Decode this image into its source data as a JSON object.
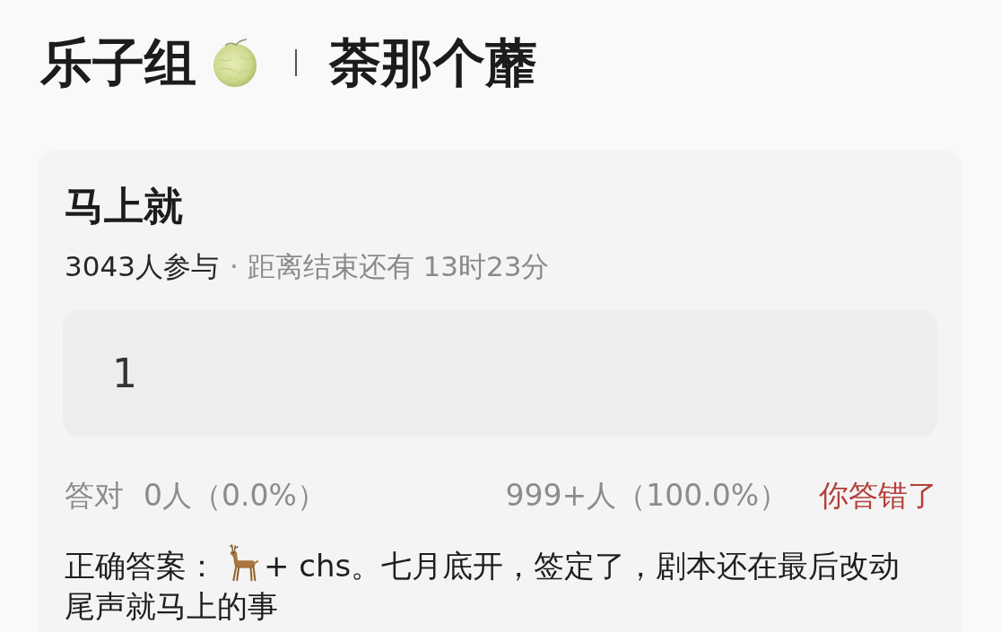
{
  "header": {
    "group": "乐子组",
    "title": "荼那个蘼"
  },
  "poll": {
    "title": "马上就",
    "participants": "3043人参与",
    "time_left": "· 距离结束还有 13时23分",
    "answer": "1",
    "stats": {
      "correct_label": "答对",
      "correct_count": "0人（0.0%）",
      "answer_count": "999+人（100.0%）",
      "result": "你答错了",
      "answered_correctly": false
    },
    "correct_answer": {
      "label": "正确答案：",
      "text": "+ chs。七月底开，签定了，剧本还在最后改动尾声就马上的事"
    }
  }
}
